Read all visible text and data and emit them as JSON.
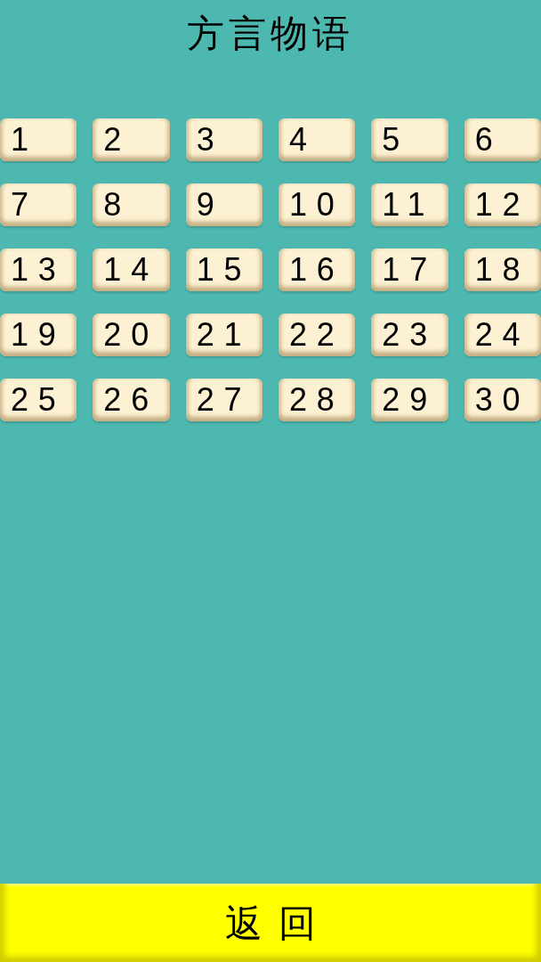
{
  "title": "方言物语",
  "levels": [
    "1",
    "2",
    "3",
    "4",
    "5",
    "6",
    "7",
    "8",
    "9",
    "10",
    "11",
    "12",
    "13",
    "14",
    "15",
    "16",
    "17",
    "18",
    "19",
    "20",
    "21",
    "22",
    "23",
    "24",
    "25",
    "26",
    "27",
    "28",
    "29",
    "30"
  ],
  "back_button": {
    "label": "返回"
  }
}
